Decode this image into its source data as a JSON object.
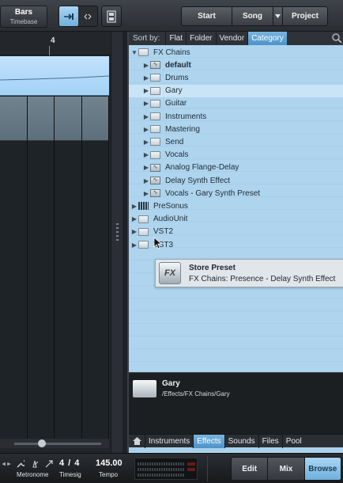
{
  "toolbar": {
    "timebase_value": "Bars",
    "timebase_label": "Timebase",
    "pages": [
      {
        "label": "Start"
      },
      {
        "label": "Song"
      },
      {
        "label": "Project"
      }
    ]
  },
  "arrange": {
    "ruler_number": "4"
  },
  "browser": {
    "sort_label": "Sort by:",
    "sort_options": [
      "Flat",
      "Folder",
      "Vendor",
      "Category"
    ],
    "active_sort": "Category",
    "tree": [
      {
        "label": "FX Chains",
        "level": 0,
        "icon": "folder-icon",
        "expanded": true
      },
      {
        "label": "default",
        "level": 1,
        "icon": "fx-chain-icon",
        "bold": true
      },
      {
        "label": "Drums",
        "level": 1,
        "icon": "folder-icon"
      },
      {
        "label": "Gary",
        "level": 1,
        "icon": "folder-icon",
        "highlighted": true
      },
      {
        "label": "Guitar",
        "level": 1,
        "icon": "folder-icon"
      },
      {
        "label": "Instruments",
        "level": 1,
        "icon": "folder-icon"
      },
      {
        "label": "Mastering",
        "level": 1,
        "icon": "folder-icon"
      },
      {
        "label": "Send",
        "level": 1,
        "icon": "folder-icon"
      },
      {
        "label": "Vocals",
        "level": 1,
        "icon": "folder-icon"
      },
      {
        "label": "Analog Flange-Delay",
        "level": 1,
        "icon": "fx-chain-icon"
      },
      {
        "label": "Delay Synth Effect",
        "level": 1,
        "icon": "fx-chain-icon"
      },
      {
        "label": "Vocals - Gary Synth Preset",
        "level": 1,
        "icon": "fx-chain-icon"
      },
      {
        "label": "PreSonus",
        "level": 0,
        "icon": "presonus-icon"
      },
      {
        "label": "AudioUnit",
        "level": 0,
        "icon": "folder-icon"
      },
      {
        "label": "VST2",
        "level": 0,
        "icon": "folder-icon"
      },
      {
        "label": "VST3",
        "level": 0,
        "icon": "folder-icon"
      }
    ],
    "drag_tooltip": {
      "icon_text": "FX",
      "title": "Store Preset",
      "subtitle": "FX Chains: Presence - Delay Synth Effect"
    },
    "info": {
      "name": "Gary",
      "path": "/Effects/FX Chains/Gary"
    },
    "tabs": [
      "Instruments",
      "Effects",
      "Sounds",
      "Files",
      "Pool"
    ],
    "active_tab": "Effects"
  },
  "transport": {
    "metronome_label": "Metronome",
    "timesig_value": "4 / 4",
    "timesig_label": "Timesig",
    "tempo_value": "145.00",
    "tempo_label": "Tempo",
    "views": [
      "Edit",
      "Mix",
      "Browse"
    ],
    "active_view": "Browse"
  },
  "colors": {
    "accent": "#6fb0dc",
    "browser_bg": "#aed4ee",
    "highlight_row": "#c9e4f6"
  }
}
